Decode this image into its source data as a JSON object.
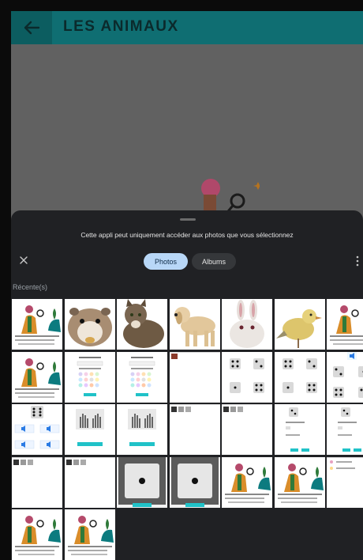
{
  "app": {
    "title": "LES ANIMAUX",
    "back_icon": "arrow-left-icon",
    "bar_color": "#0f6e72"
  },
  "picker": {
    "notice": "Cette appli peut uniquement accéder aux photos que vous sélectionnez",
    "tabs": [
      {
        "label": "Photos",
        "selected": true
      },
      {
        "label": "Albums",
        "selected": false
      }
    ],
    "section_label": "Récente(s)",
    "close_icon": "close-icon",
    "more_icon": "more-vertical-icon",
    "accent": "#b8d7f7"
  },
  "photos": [
    {
      "kind": "illustration"
    },
    {
      "kind": "hamster"
    },
    {
      "kind": "cat"
    },
    {
      "kind": "dog"
    },
    {
      "kind": "rabbit"
    },
    {
      "kind": "bird"
    },
    {
      "kind": "illustration"
    },
    {
      "kind": "illustration"
    },
    {
      "kind": "color-form"
    },
    {
      "kind": "color-form"
    },
    {
      "kind": "blank-thumb"
    },
    {
      "kind": "dice-grid"
    },
    {
      "kind": "dice-grid"
    },
    {
      "kind": "dice-sound"
    },
    {
      "kind": "sound-buttons"
    },
    {
      "kind": "hands"
    },
    {
      "kind": "hands"
    },
    {
      "kind": "blank-thumbs"
    },
    {
      "kind": "blank-thumbs"
    },
    {
      "kind": "dice-form"
    },
    {
      "kind": "dice-form"
    },
    {
      "kind": "blank-thumbs"
    },
    {
      "kind": "blank-thumbs"
    },
    {
      "kind": "dice-photo"
    },
    {
      "kind": "dice-photo"
    },
    {
      "kind": "illustration"
    },
    {
      "kind": "illustration"
    },
    {
      "kind": "list-screen"
    },
    {
      "kind": "illustration"
    },
    {
      "kind": "illustration"
    }
  ]
}
